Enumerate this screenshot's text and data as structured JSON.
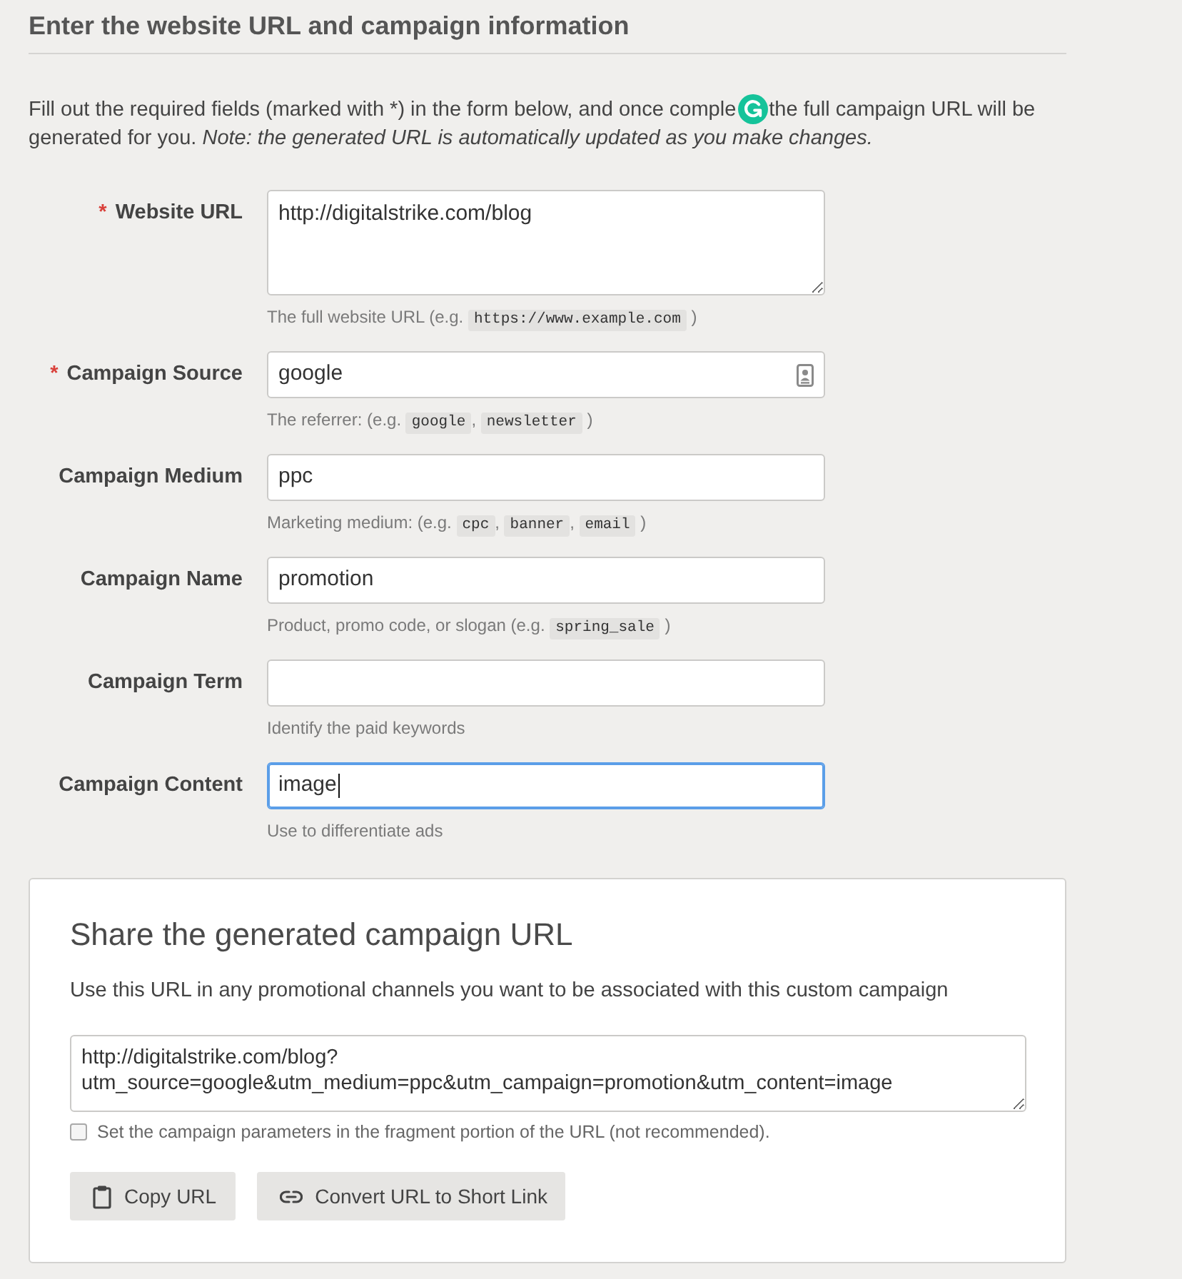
{
  "heading": "Enter the website URL and campaign information",
  "intro": {
    "before_icon": "Fill out the required fields (marked with *) in the form below, and once comple",
    "after_icon": "the full campaign URL will be",
    "continued": "generated for you. *Note: the generated URL is automatically updated as you make changes.*"
  },
  "fields": [
    {
      "label": "Website URL",
      "required_mark": "*",
      "kind": "textarea",
      "value": "http://digitalstrike.com/blog",
      "focused": false,
      "help": [
        {
          "kind": "text",
          "text": "The full website URL (e.g. "
        },
        {
          "kind": "code",
          "text": "https://www.example.com"
        },
        {
          "kind": "text",
          "text": " )"
        }
      ]
    },
    {
      "label": "Campaign Source",
      "required_mark": "*",
      "kind": "input",
      "value": "google",
      "focused": false,
      "autofill_icon": true,
      "help": [
        {
          "kind": "text",
          "text": "The referrer: (e.g. "
        },
        {
          "kind": "code",
          "text": "google"
        },
        {
          "kind": "text",
          "text": ", "
        },
        {
          "kind": "code",
          "text": "newsletter"
        },
        {
          "kind": "text",
          "text": " )"
        }
      ]
    },
    {
      "label": "Campaign Medium",
      "kind": "input",
      "value": "ppc",
      "focused": false,
      "autofill_icon": false,
      "help": [
        {
          "kind": "text",
          "text": "Marketing medium: (e.g. "
        },
        {
          "kind": "code",
          "text": "cpc"
        },
        {
          "kind": "text",
          "text": ", "
        },
        {
          "kind": "code",
          "text": "banner"
        },
        {
          "kind": "text",
          "text": ", "
        },
        {
          "kind": "code",
          "text": "email"
        },
        {
          "kind": "text",
          "text": " )"
        }
      ]
    },
    {
      "label": "Campaign Name",
      "kind": "input",
      "value": "promotion",
      "focused": false,
      "autofill_icon": false,
      "help": [
        {
          "kind": "text",
          "text": "Product, promo code, or slogan (e.g. "
        },
        {
          "kind": "code",
          "text": "spring_sale"
        },
        {
          "kind": "text",
          "text": " )"
        }
      ]
    },
    {
      "label": "Campaign Term",
      "kind": "input",
      "focused": false,
      "autofill_icon": false,
      "help": [
        {
          "kind": "text",
          "text": "Identify the paid keywords"
        }
      ]
    },
    {
      "label": "Campaign Content",
      "kind": "input",
      "value": "image",
      "focused": true,
      "autofill_icon": false,
      "help": [
        {
          "kind": "text",
          "text": "Use to differentiate ads"
        }
      ]
    }
  ],
  "share": {
    "title": "Share the generated campaign URL",
    "description": "Use this URL in any promotional channels you want to be associated with this custom campaign",
    "generated_url": "http://digitalstrike.com/blog?utm_source=google&utm_medium=ppc&utm_campaign=promotion&utm_content=image",
    "fragment_option": {
      "label": "Set the campaign parameters in the fragment portion of the URL (not recommended).",
      "checked": false
    },
    "buttons": [
      {
        "kind": "copy",
        "label": "Copy URL"
      },
      {
        "kind": "link",
        "label": "Convert URL to Short Link"
      }
    ]
  }
}
